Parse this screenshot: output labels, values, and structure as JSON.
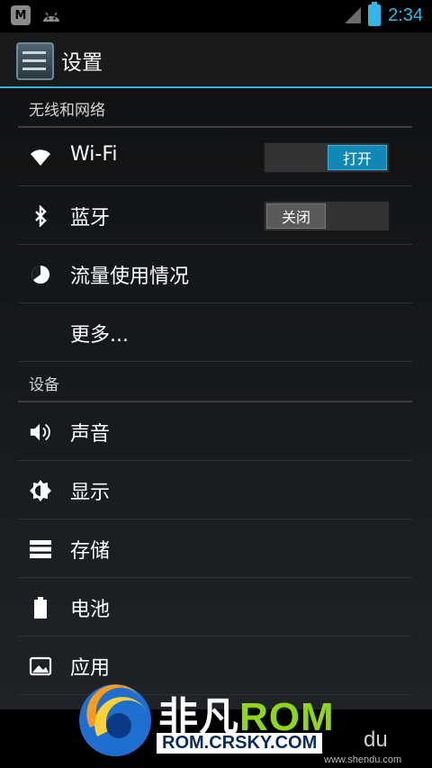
{
  "status_bar": {
    "notification_icons": [
      "m-icon",
      "android-icon"
    ],
    "time": "2:34",
    "accent_color": "#33b5e5"
  },
  "action_bar": {
    "title": "设置"
  },
  "sections": {
    "wireless": {
      "header": "无线和网络",
      "wifi": {
        "label": "Wi-Fi",
        "switch": "打开",
        "state": "on"
      },
      "bluetooth": {
        "label": "蓝牙",
        "switch": "关闭",
        "state": "off"
      },
      "data_usage": {
        "label": "流量使用情况"
      },
      "more": {
        "label": "更多..."
      }
    },
    "device": {
      "header": "设备",
      "sound": {
        "label": "声音"
      },
      "display": {
        "label": "显示"
      },
      "storage": {
        "label": "存储"
      },
      "battery": {
        "label": "电池"
      },
      "apps": {
        "label": "应用"
      }
    }
  },
  "watermark": {
    "title_cn": "非凡",
    "title_rom": "ROM",
    "url": "ROM.CRSKY.COM",
    "du_text": "du",
    "small_url": "www.shendu.com"
  }
}
